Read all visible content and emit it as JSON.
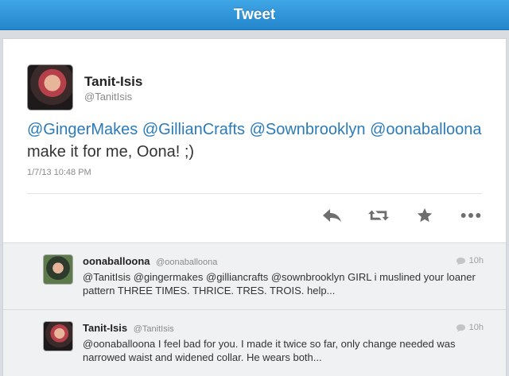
{
  "header": {
    "title": "Tweet"
  },
  "tweet": {
    "name": "Tanit-Isis",
    "handle": "@TanitIsis",
    "mentions": [
      "@GingerMakes",
      "@GillianCrafts",
      "@Sownbrooklyn",
      "@oonaballoona"
    ],
    "text": "make it for me, Oona! ;)",
    "timestamp": "1/7/13 10:48 PM",
    "actions": [
      "reply-icon",
      "retweet-icon",
      "favorite-icon",
      "more-icon"
    ]
  },
  "replies": [
    {
      "name": "oonaballoona",
      "handle": "@oonaballoona",
      "time": "10h",
      "text": "@TanitIsis @gingermakes @gilliancrafts @sownbrooklyn GIRL i muslined your loaner pattern THREE TIMES. THRICE. TRES. TROIS. help..."
    },
    {
      "name": "Tanit-Isis",
      "handle": "@TanitIsis",
      "time": "10h",
      "text": "@oonaballoona I feel bad for you. I made it twice so far, only change needed was narrowed waist and widened collar. He wears both..."
    }
  ],
  "colors": {
    "header": "#2486cc",
    "mention": "#2b7bb9"
  }
}
